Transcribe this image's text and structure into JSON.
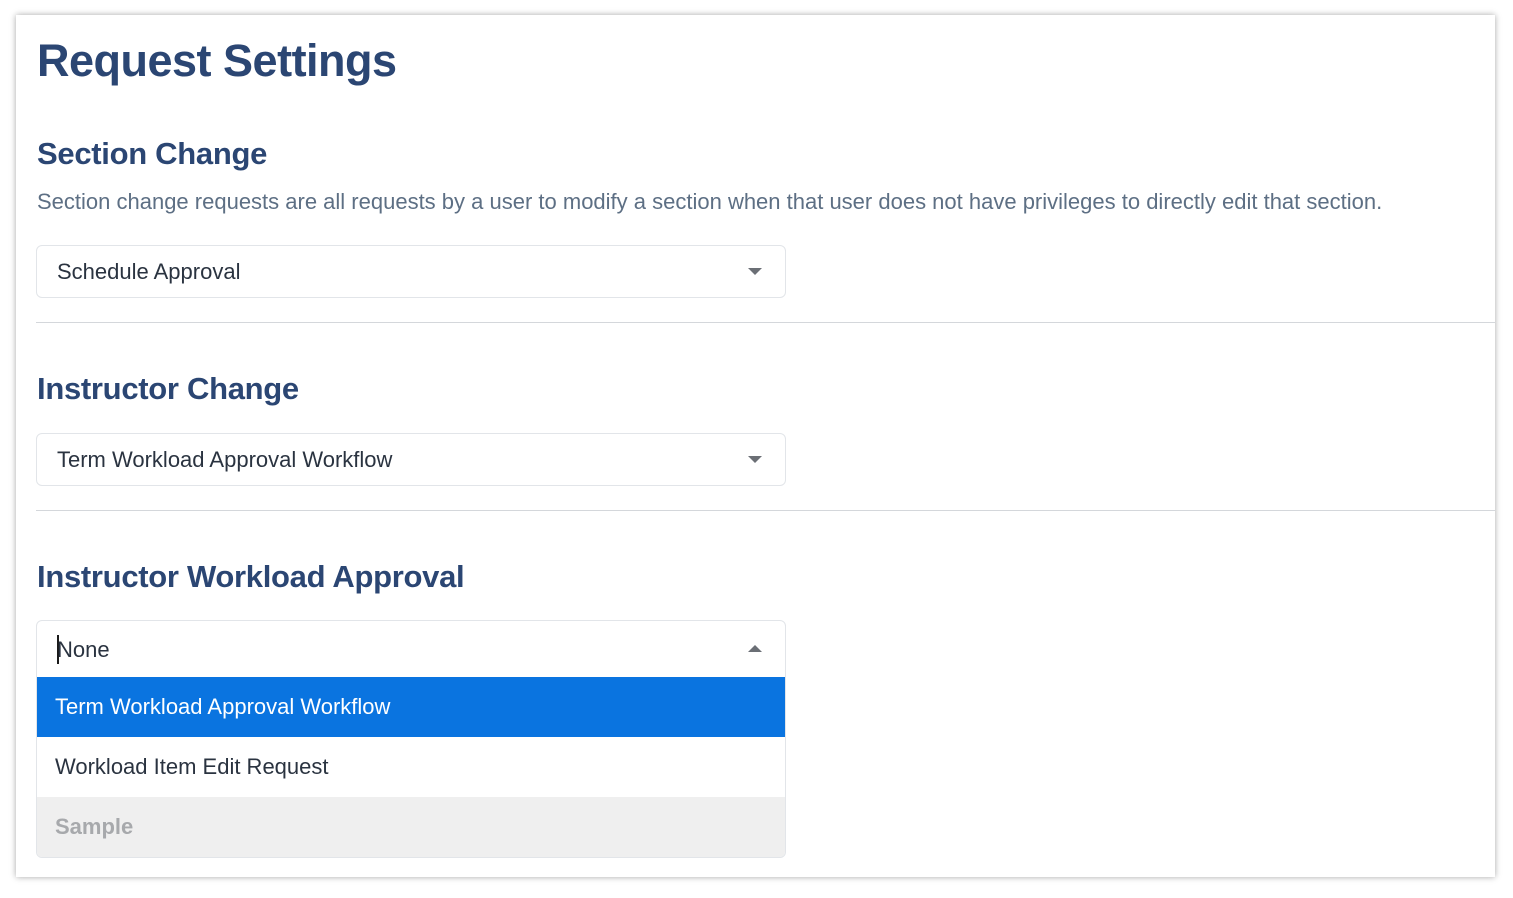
{
  "page": {
    "title": "Request Settings"
  },
  "section_change": {
    "heading": "Section Change",
    "description": "Section change requests are all requests by a user to modify a section when that user does not have privileges to directly edit that section.",
    "selected": "Schedule Approval",
    "icon": "chevron-down-icon"
  },
  "instructor_change": {
    "heading": "Instructor Change",
    "selected": "Term Workload Approval Workflow",
    "icon": "chevron-down-icon"
  },
  "instructor_workload_approval": {
    "heading": "Instructor Workload Approval",
    "selected": "None",
    "icon": "chevron-up-icon",
    "dropdown_open": true,
    "options": [
      {
        "label": "Term Workload Approval Workflow",
        "state": "highlighted"
      },
      {
        "label": "Workload Item Edit Request",
        "state": "normal"
      },
      {
        "label": "Sample",
        "state": "disabled"
      }
    ]
  },
  "colors": {
    "heading": "#2b4673",
    "description": "#5d6f84",
    "highlight": "#0a74e0",
    "disabled_bg": "#efefef",
    "disabled_text": "#a7a9ac"
  }
}
